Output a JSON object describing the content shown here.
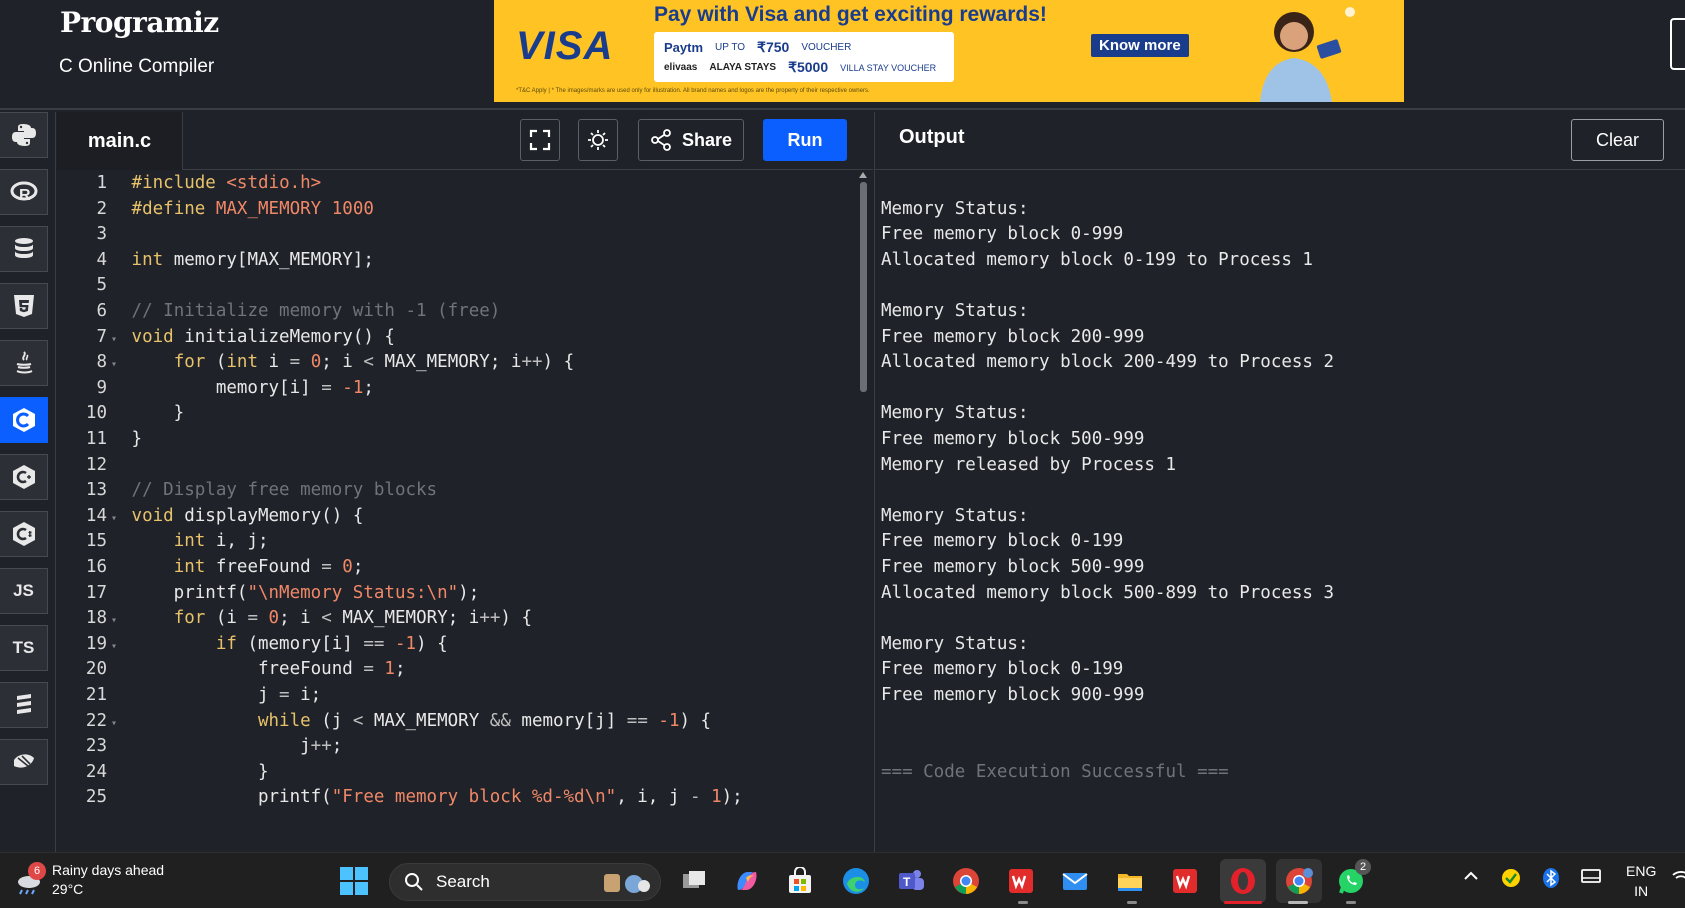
{
  "header": {
    "logo": "Programiz",
    "subtitle": "C Online Compiler"
  },
  "ad": {
    "brand": "VISA",
    "headline": "Pay with Visa and get exciting rewards!",
    "offer1_brand": "Paytm",
    "offer1_prefix": "UP TO",
    "offer1_amount": "₹750",
    "offer1_suffix": "VOUCHER",
    "offer2_brand1": "elivaas",
    "offer2_brand2": "ALAYA STAYS",
    "offer2_amount": "₹5000",
    "offer2_suffix": "VILLA STAY VOUCHER",
    "cta": "Know more",
    "fine_print": "*T&C Apply | * The images/marks are used only for illustration. All brand names and logos are the property of their respective owners."
  },
  "sidebar": {
    "languages": [
      {
        "name": "python",
        "label": ""
      },
      {
        "name": "r",
        "label": ""
      },
      {
        "name": "sql",
        "label": ""
      },
      {
        "name": "html",
        "label": ""
      },
      {
        "name": "java",
        "label": ""
      },
      {
        "name": "c",
        "label": "",
        "active": true
      },
      {
        "name": "cpp",
        "label": ""
      },
      {
        "name": "csharp",
        "label": ""
      },
      {
        "name": "javascript",
        "label": "JS"
      },
      {
        "name": "typescript",
        "label": "TS"
      },
      {
        "name": "scala",
        "label": ""
      },
      {
        "name": "go",
        "label": ""
      }
    ]
  },
  "editor": {
    "filename": "main.c",
    "share_label": "Share",
    "run_label": "Run",
    "lines": [
      {
        "n": "1",
        "text": "#include <stdio.h>",
        "fold": ""
      },
      {
        "n": "2",
        "text": "#define MAX_MEMORY 1000",
        "fold": ""
      },
      {
        "n": "3",
        "text": "",
        "fold": ""
      },
      {
        "n": "4",
        "text": "int memory[MAX_MEMORY];",
        "fold": ""
      },
      {
        "n": "5",
        "text": "",
        "fold": ""
      },
      {
        "n": "6",
        "text": "// Initialize memory with -1 (free)",
        "fold": ""
      },
      {
        "n": "7",
        "text": "void initializeMemory() {",
        "fold": "▾"
      },
      {
        "n": "8",
        "text": "    for (int i = 0; i < MAX_MEMORY; i++) {",
        "fold": "▾"
      },
      {
        "n": "9",
        "text": "        memory[i] = -1;",
        "fold": ""
      },
      {
        "n": "10",
        "text": "    }",
        "fold": ""
      },
      {
        "n": "11",
        "text": "}",
        "fold": ""
      },
      {
        "n": "12",
        "text": "",
        "fold": ""
      },
      {
        "n": "13",
        "text": "// Display free memory blocks",
        "fold": ""
      },
      {
        "n": "14",
        "text": "void displayMemory() {",
        "fold": "▾"
      },
      {
        "n": "15",
        "text": "    int i, j;",
        "fold": ""
      },
      {
        "n": "16",
        "text": "    int freeFound = 0;",
        "fold": ""
      },
      {
        "n": "17",
        "text": "    printf(\"\\nMemory Status:\\n\");",
        "fold": ""
      },
      {
        "n": "18",
        "text": "    for (i = 0; i < MAX_MEMORY; i++) {",
        "fold": "▾"
      },
      {
        "n": "19",
        "text": "        if (memory[i] == -1) {",
        "fold": "▾"
      },
      {
        "n": "20",
        "text": "            freeFound = 1;",
        "fold": ""
      },
      {
        "n": "21",
        "text": "            j = i;",
        "fold": ""
      },
      {
        "n": "22",
        "text": "            while (j < MAX_MEMORY && memory[j] == -1) {",
        "fold": "▾"
      },
      {
        "n": "23",
        "text": "                j++;",
        "fold": ""
      },
      {
        "n": "24",
        "text": "            }",
        "fold": ""
      },
      {
        "n": "25",
        "text": "            printf(\"Free memory block %d-%d\\n\", i, j - 1);",
        "fold": ""
      }
    ]
  },
  "output": {
    "title": "Output",
    "clear_label": "Clear",
    "lines": [
      "",
      "Memory Status:",
      "Free memory block 0-999",
      "Allocated memory block 0-199 to Process 1",
      "",
      "Memory Status:",
      "Free memory block 200-999",
      "Allocated memory block 200-499 to Process 2",
      "",
      "Memory Status:",
      "Free memory block 500-999",
      "Memory released by Process 1",
      "",
      "Memory Status:",
      "Free memory block 0-199",
      "Free memory block 500-999",
      "Allocated memory block 500-899 to Process 3",
      "",
      "Memory Status:",
      "Free memory block 0-199",
      "Free memory block 900-999",
      "",
      "",
      "=== Code Execution Successful ==="
    ]
  },
  "taskbar": {
    "weather_badge": "6",
    "weather_title": "Rainy days ahead",
    "weather_temp": "29°C",
    "search_placeholder": "Search",
    "whatsapp_badge": "2",
    "lang_line1": "ENG",
    "lang_line2": "IN"
  },
  "colors": {
    "accent": "#0b5fff",
    "background": "#1f2228",
    "keyword": "#e8c26b",
    "string": "#f08868",
    "comment": "#6f737a",
    "number": "#f08868",
    "ad_yellow": "#ffc423",
    "visa_blue": "#1a3c8c"
  }
}
